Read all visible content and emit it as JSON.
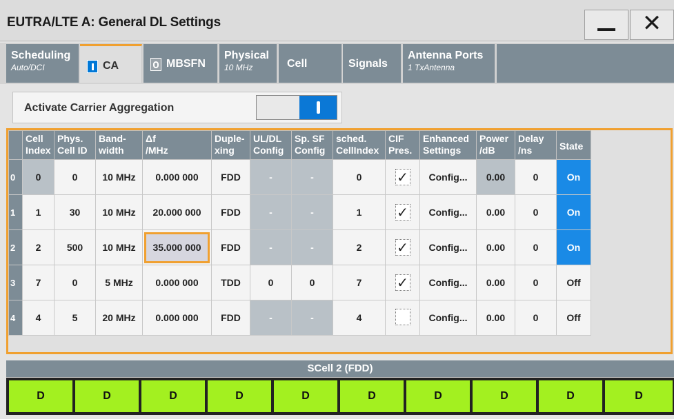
{
  "window": {
    "title": "EUTRA/LTE A: General DL Settings",
    "minimize_label": "—",
    "close_label": "✕"
  },
  "tabs": [
    {
      "label": "Scheduling",
      "sub": "Auto/DCI"
    },
    {
      "label": "CA",
      "sub": "",
      "toggle": "on",
      "active": true
    },
    {
      "label": "MBSFN",
      "sub": "",
      "toggle": "off"
    },
    {
      "label": "Physical",
      "sub": "10 MHz"
    },
    {
      "label": "Cell",
      "sub": ""
    },
    {
      "label": "Signals",
      "sub": ""
    },
    {
      "label": "Antenna Ports",
      "sub": "1 TxAntenna"
    }
  ],
  "activate": {
    "label": "Activate Carrier Aggregation",
    "state": "on"
  },
  "table": {
    "headers": [
      [
        "Cell",
        "Index"
      ],
      [
        "Phys.",
        "Cell ID"
      ],
      [
        "Band-",
        "width"
      ],
      [
        "Δf",
        "/MHz"
      ],
      [
        "Duple-",
        "xing"
      ],
      [
        "UL/DL",
        "Config"
      ],
      [
        "Sp. SF",
        "Config"
      ],
      [
        "sched.",
        "CellIndex"
      ],
      [
        "CIF",
        "Pres."
      ],
      [
        "Enhanced",
        "Settings"
      ],
      [
        "Power",
        "/dB"
      ],
      [
        "Delay",
        "/ns"
      ],
      [
        "State",
        ""
      ]
    ],
    "rows": [
      {
        "row": "0",
        "cell_index": "0",
        "phys_cell_id": "0",
        "bandwidth": "10 MHz",
        "df": "0.000 000",
        "duplexing": "FDD",
        "ul_dl": "-",
        "sp_sf": "-",
        "sched": "0",
        "cif": true,
        "enhanced": "Config...",
        "power": "0.00",
        "delay": "0",
        "state": "On"
      },
      {
        "row": "1",
        "cell_index": "1",
        "phys_cell_id": "30",
        "bandwidth": "10 MHz",
        "df": "20.000 000",
        "duplexing": "FDD",
        "ul_dl": "-",
        "sp_sf": "-",
        "sched": "1",
        "cif": true,
        "enhanced": "Config...",
        "power": "0.00",
        "delay": "0",
        "state": "On"
      },
      {
        "row": "2",
        "cell_index": "2",
        "phys_cell_id": "500",
        "bandwidth": "10 MHz",
        "df": "35.000 000",
        "duplexing": "FDD",
        "ul_dl": "-",
        "sp_sf": "-",
        "sched": "2",
        "cif": true,
        "enhanced": "Config...",
        "power": "0.00",
        "delay": "0",
        "state": "On"
      },
      {
        "row": "3",
        "cell_index": "7",
        "phys_cell_id": "0",
        "bandwidth": "5 MHz",
        "df": "0.000 000",
        "duplexing": "TDD",
        "ul_dl": "0",
        "sp_sf": "0",
        "sched": "7",
        "cif": true,
        "enhanced": "Config...",
        "power": "0.00",
        "delay": "0",
        "state": "Off"
      },
      {
        "row": "4",
        "cell_index": "4",
        "phys_cell_id": "5",
        "bandwidth": "20 MHz",
        "df": "0.000 000",
        "duplexing": "FDD",
        "ul_dl": "-",
        "sp_sf": "-",
        "sched": "4",
        "cif": false,
        "enhanced": "Config...",
        "power": "0.00",
        "delay": "0",
        "state": "Off"
      }
    ]
  },
  "scell": {
    "title": "SCell 2 (FDD)",
    "subframes": [
      "D",
      "D",
      "D",
      "D",
      "D",
      "D",
      "D",
      "D",
      "D",
      "D"
    ]
  },
  "colors": {
    "tab_bg": "#7d8c96",
    "accent_orange": "#f0a030",
    "state_on": "#1a8ae6",
    "subframe_green": "#a3f020"
  }
}
